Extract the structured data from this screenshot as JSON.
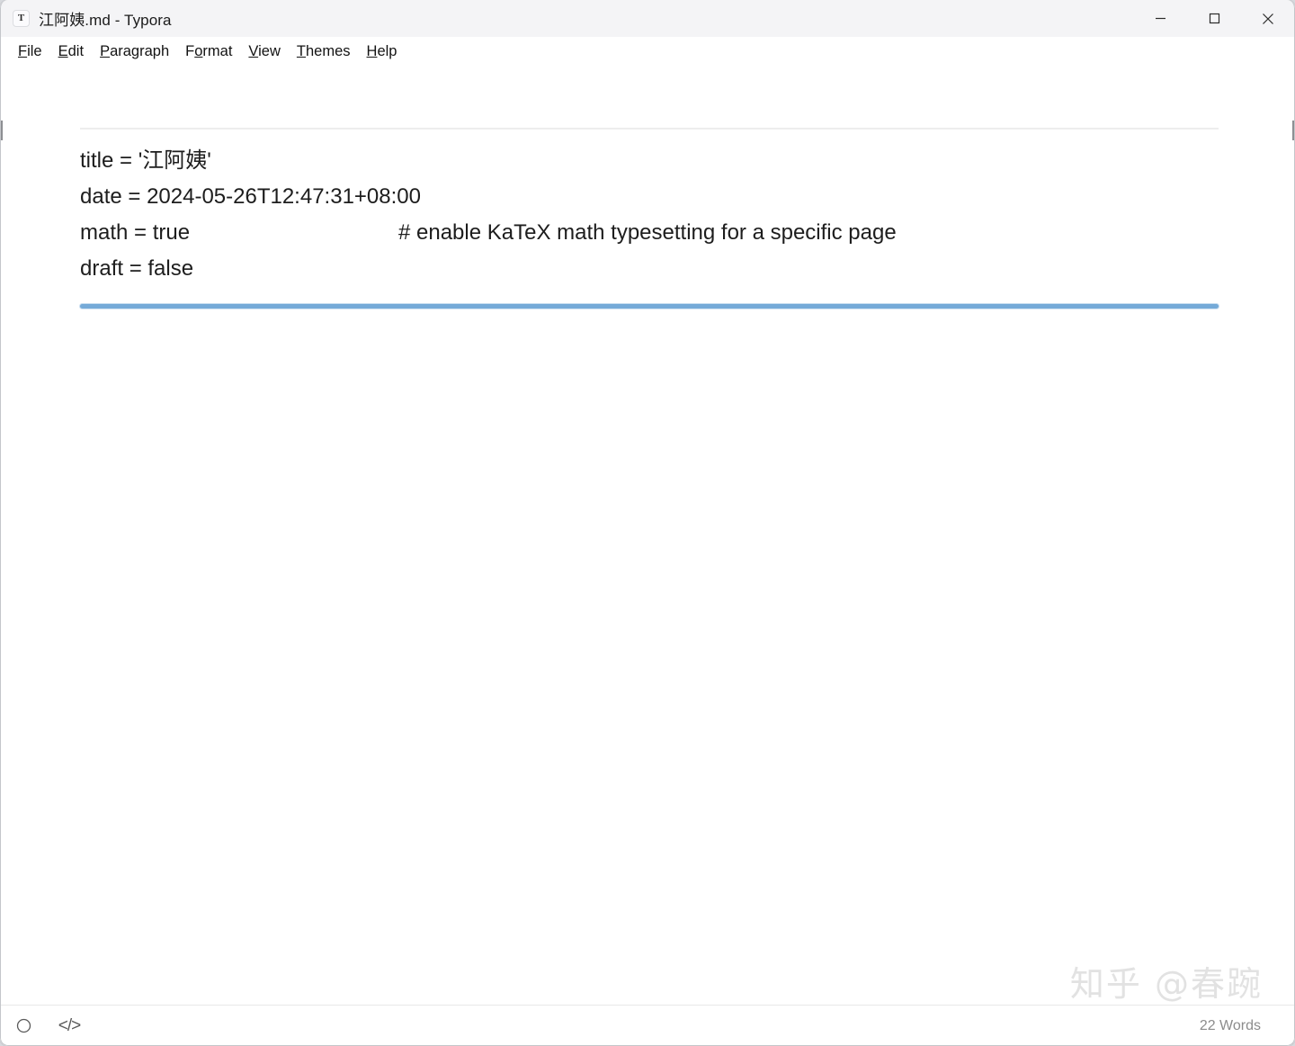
{
  "window": {
    "app_icon_glyph": "T",
    "title": "江阿姨.md - Typora",
    "controls": {
      "minimize": "minimize-icon",
      "maximize": "maximize-icon",
      "close": "close-icon"
    }
  },
  "menubar": {
    "items": [
      {
        "label": "File",
        "accel": "F",
        "rest": "ile"
      },
      {
        "label": "Edit",
        "accel": "E",
        "rest": "dit"
      },
      {
        "label": "Paragraph",
        "accel": "P",
        "rest": "aragraph"
      },
      {
        "label": "Format",
        "pre": "F",
        "accel": "o",
        "rest": "rmat"
      },
      {
        "label": "View",
        "accel": "V",
        "rest": "iew"
      },
      {
        "label": "Themes",
        "accel": "T",
        "rest": "hemes"
      },
      {
        "label": "Help",
        "accel": "H",
        "rest": "elp"
      }
    ]
  },
  "document": {
    "frontmatter_lines": [
      {
        "text": "title = '江阿姨'",
        "comment": ""
      },
      {
        "text": "date = 2024-05-26T12:47:31+08:00",
        "comment": ""
      },
      {
        "text": "math = true",
        "comment": "# enable KaTeX math typesetting for a specific page"
      },
      {
        "text": "draft = false",
        "comment": ""
      }
    ],
    "rule_color": "#75aad8"
  },
  "watermark": {
    "text": "知乎 @春踠"
  },
  "statusbar": {
    "outline_icon": "circle-outline-icon",
    "source_code_icon": "</>",
    "word_count": "22 Words"
  }
}
